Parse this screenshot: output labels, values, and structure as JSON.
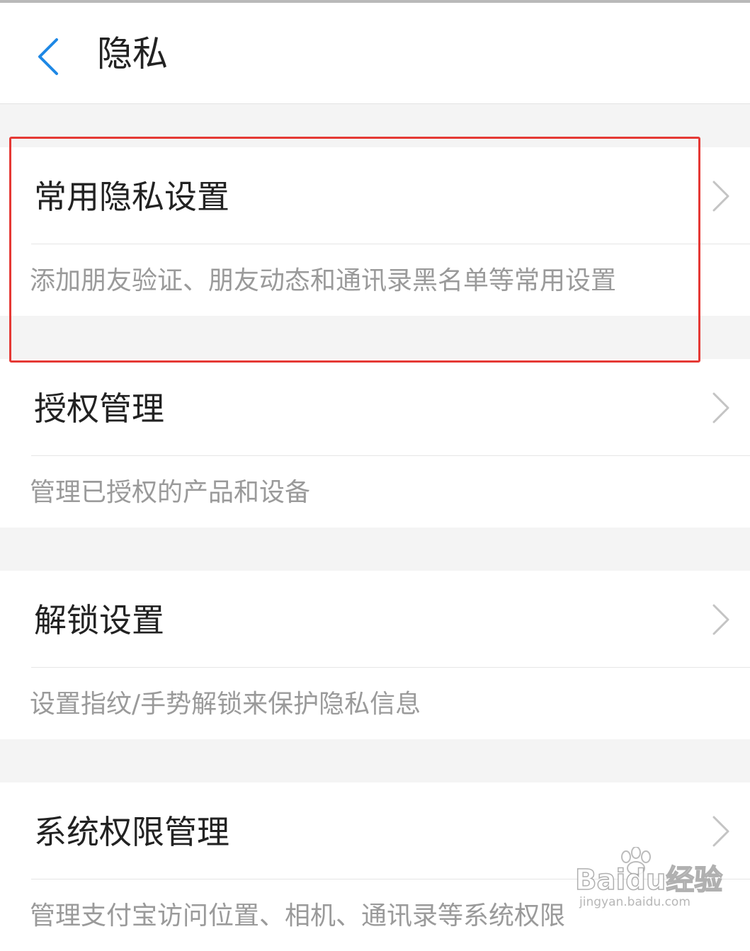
{
  "header": {
    "title": "隐私",
    "back_icon": "chevron-left-icon",
    "accent_color": "#1e88e5"
  },
  "sections": [
    {
      "title": "常用隐私设置",
      "description": "添加朋友验证、朋友动态和通讯录黑名单等常用设置",
      "icon": "chevron-right-icon",
      "highlighted": true
    },
    {
      "title": "授权管理",
      "description": "管理已授权的产品和设备",
      "icon": "chevron-right-icon"
    },
    {
      "title": "解锁设置",
      "description": "设置指纹/手势解锁来保护隐私信息",
      "icon": "chevron-right-icon"
    },
    {
      "title": "系统权限管理",
      "description": "管理支付宝访问位置、相机、通讯录等系统权限",
      "icon": "chevron-right-icon"
    }
  ],
  "annotation": {
    "color": "#e53935"
  },
  "watermark": {
    "main": "Baidu经验",
    "sub": "jingyan.baidu.com"
  }
}
